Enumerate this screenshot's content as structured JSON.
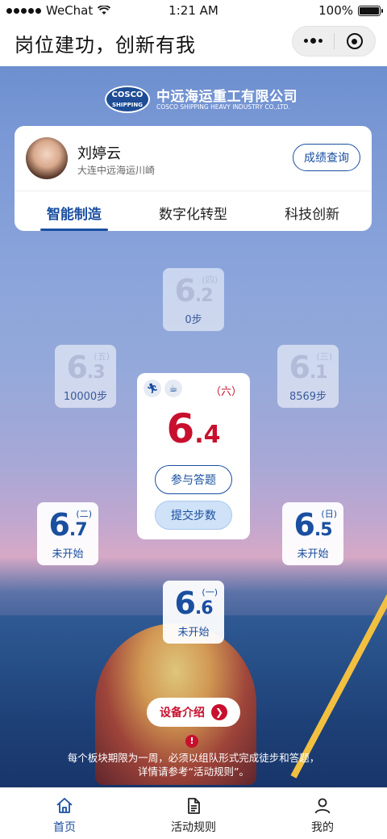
{
  "status_bar": {
    "carrier": "WeChat",
    "time": "1:21 AM",
    "battery": "100%"
  },
  "nav": {
    "title": "岗位建功，创新有我"
  },
  "logo": {
    "badge_top": "COSCO",
    "badge_bottom": "SHIPPING",
    "name_cn": "中远海运重工有限公司",
    "name_en": "COSCO SHIPPING HEAVY INDUSTRY CO.,LTD."
  },
  "profile": {
    "name": "刘婷云",
    "company": "大连中远海运川崎",
    "score_button": "成绩查询"
  },
  "tabs": [
    {
      "label": "智能制造",
      "active": true
    },
    {
      "label": "数字化转型",
      "active": false
    },
    {
      "label": "科技创新",
      "active": false
    }
  ],
  "days": {
    "top": {
      "month": "6",
      "day": ".2",
      "weekday": "(四)",
      "status": "0步"
    },
    "upper_left": {
      "month": "6",
      "day": ".3",
      "weekday": "(五)",
      "status": "10000步"
    },
    "upper_right": {
      "month": "6",
      "day": ".1",
      "weekday": "(三)",
      "status": "8569步"
    },
    "lower_left": {
      "month": "6",
      "day": ".7",
      "weekday": "(二)",
      "status": "未开始"
    },
    "lower_right": {
      "month": "6",
      "day": ".5",
      "weekday": "(日)",
      "status": "未开始"
    },
    "bottom": {
      "month": "6",
      "day": ".6",
      "weekday": "(一)",
      "status": "未开始"
    }
  },
  "today": {
    "month": "6",
    "day": ".4",
    "weekday": "（六）",
    "answer_button": "参与答题",
    "submit_button": "提交步数",
    "icons": [
      "run-icon",
      "cup-icon"
    ]
  },
  "device_intro": {
    "label": "设备介绍"
  },
  "notice": {
    "line1": "每个板块期限为一周，必须以组队形式完成徒步和答题，",
    "line2": "详情请参考“活动规则”。"
  },
  "tabbar": [
    {
      "label": "首页",
      "icon": "home-icon",
      "active": true
    },
    {
      "label": "活动规则",
      "icon": "document-icon",
      "active": false
    },
    {
      "label": "我的",
      "icon": "user-icon",
      "active": false
    }
  ],
  "colors": {
    "brand_blue": "#1a4fa0",
    "accent_red": "#c8102e"
  }
}
